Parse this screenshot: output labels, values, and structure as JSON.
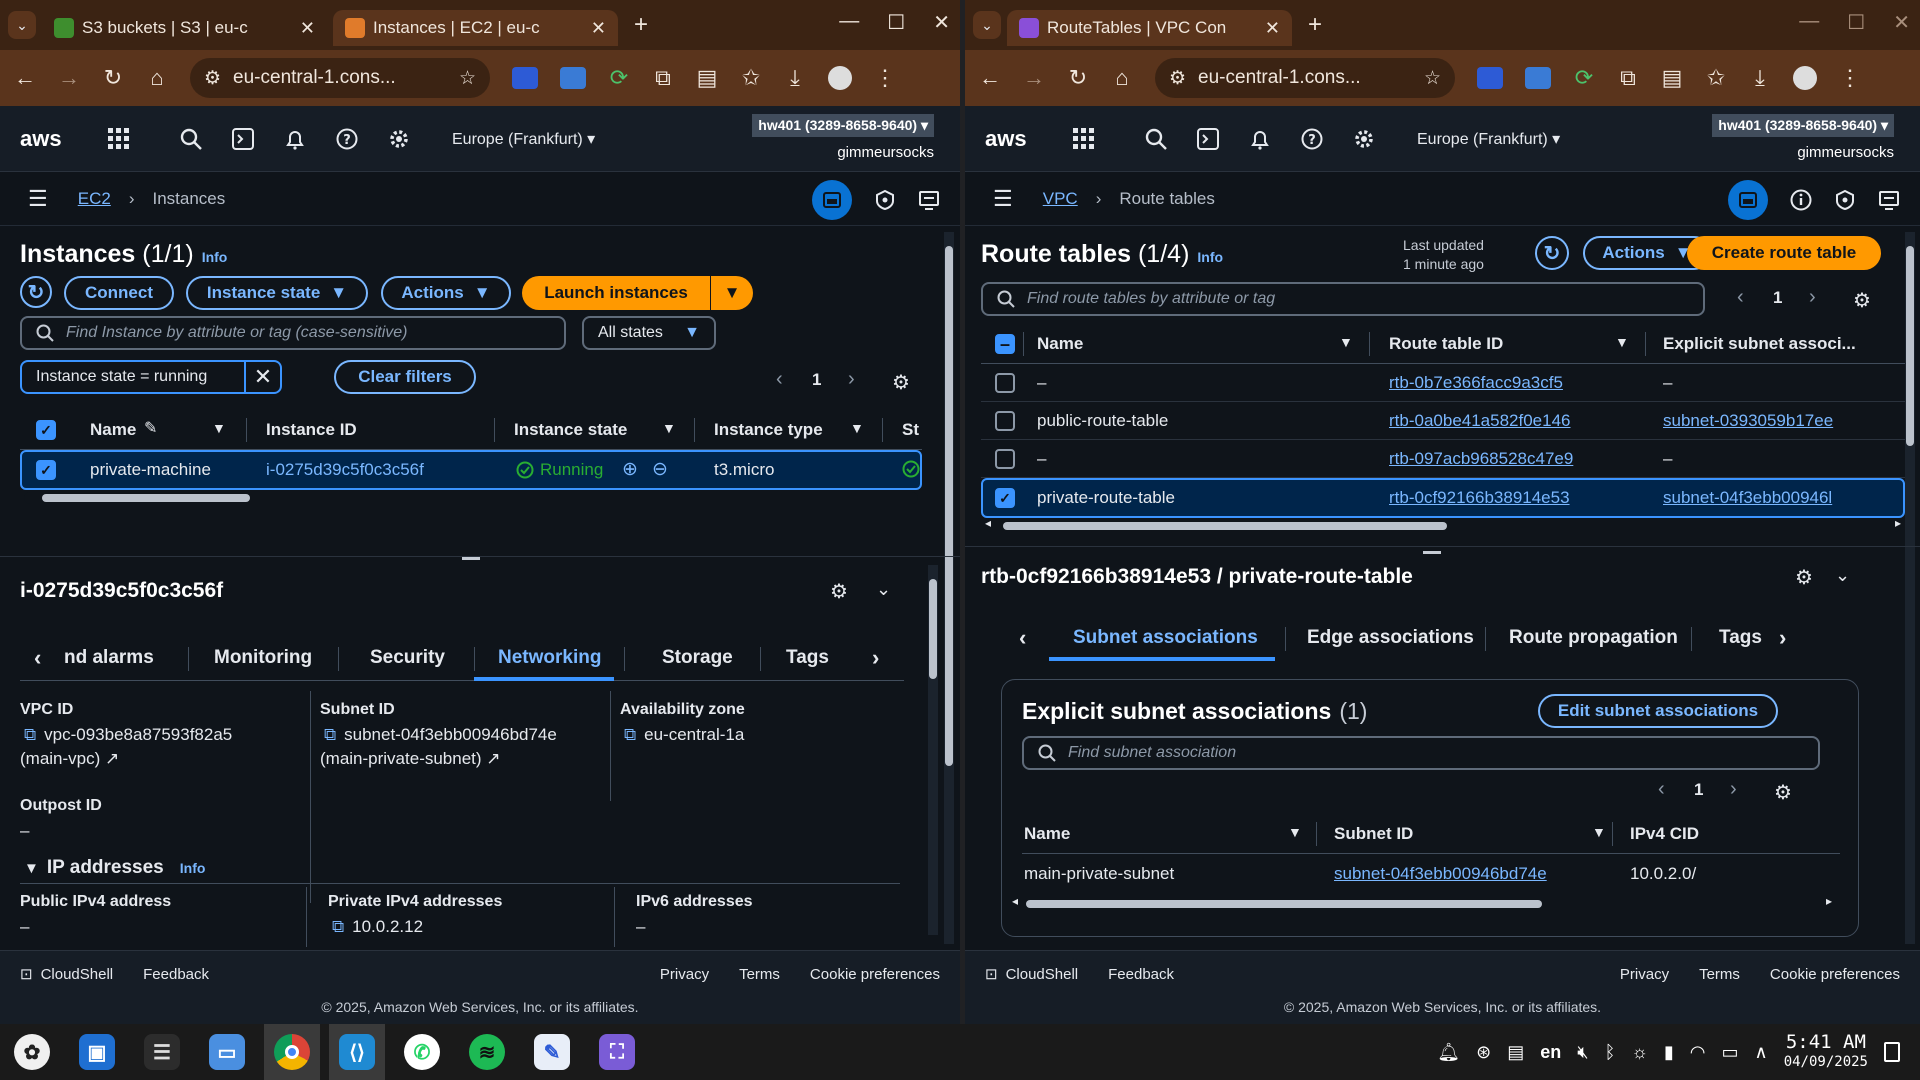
{
  "left": {
    "browser": {
      "tabs": [
        {
          "title": "S3 buckets | S3 | eu-c",
          "fav_color": "#3e8e2e",
          "active": false
        },
        {
          "title": "Instances | EC2 | eu-c",
          "fav_color": "#e07b2b",
          "active": true
        }
      ],
      "url": "eu-central-1.cons..."
    },
    "aws": {
      "region": "Europe (Frankfurt)",
      "account": "hw401 (3289-8658-9640)",
      "user": "gimmeursocks"
    },
    "breadcrumb": {
      "service": "EC2",
      "page": "Instances"
    },
    "page": {
      "title": "Instances",
      "count": "(1/1)",
      "info": "Info",
      "buttons": {
        "connect": "Connect",
        "instance_state": "Instance state",
        "actions": "Actions",
        "launch": "Launch instances"
      },
      "search_placeholder": "Find Instance by attribute or tag (case-sensitive)",
      "states_select": "All states",
      "filter_token": "Instance state = running",
      "clear_filters": "Clear filters",
      "page_num": "1",
      "columns": [
        "Name",
        "Instance ID",
        "Instance state",
        "Instance type",
        "St"
      ],
      "row": {
        "name": "private-machine",
        "id": "i-0275d39c5f0c3c56f",
        "state": "Running",
        "type": "t3.micro"
      }
    },
    "details": {
      "title": "i-0275d39c5f0c3c56f",
      "tabs": [
        "nd alarms",
        "Monitoring",
        "Security",
        "Networking",
        "Storage",
        "Tags"
      ],
      "active_tab": "Networking",
      "vpc_label": "VPC ID",
      "vpc_value": "vpc-093be8a87593f82a5",
      "vpc_name": "(main-vpc)",
      "subnet_label": "Subnet ID",
      "subnet_value": "subnet-04f3ebb00946bd74e",
      "subnet_name": "(main-private-subnet)",
      "az_label": "Availability zone",
      "az_value": "eu-central-1a",
      "outpost_label": "Outpost ID",
      "outpost_value": "–",
      "ip_section": "IP addresses",
      "ip_info": "Info",
      "public_label": "Public IPv4 address",
      "public_value": "–",
      "private_label": "Private IPv4 addresses",
      "private_value": "10.0.2.12",
      "ipv6_label": "IPv6 addresses",
      "ipv6_value": "–"
    },
    "footer": {
      "cloudshell": "CloudShell",
      "feedback": "Feedback",
      "privacy": "Privacy",
      "terms": "Terms",
      "cookies": "Cookie preferences",
      "copyright": "© 2025, Amazon Web Services, Inc. or its affiliates."
    }
  },
  "right": {
    "browser": {
      "tabs": [
        {
          "title": "RouteTables | VPC Con",
          "fav_color": "#8a4fd8",
          "active": true
        }
      ],
      "url": "eu-central-1.cons..."
    },
    "aws": {
      "region": "Europe (Frankfurt)",
      "account": "hw401 (3289-8658-9640)",
      "user": "gimmeursocks"
    },
    "breadcrumb": {
      "service": "VPC",
      "page": "Route tables"
    },
    "page": {
      "title": "Route tables",
      "count": "(1/4)",
      "info": "Info",
      "last_updated_1": "Last updated",
      "last_updated_2": "1 minute ago",
      "actions": "Actions",
      "create": "Create route table",
      "search_placeholder": "Find route tables by attribute or tag",
      "page_num": "1",
      "columns": [
        "Name",
        "Route table ID",
        "Explicit subnet associ..."
      ],
      "rows": [
        {
          "name": "–",
          "id": "rtb-0b7e366facc9a3cf5",
          "subnet": "–",
          "checked": false
        },
        {
          "name": "public-route-table",
          "id": "rtb-0a0be41a582f0e146",
          "subnet": "subnet-0393059b17ee",
          "checked": false
        },
        {
          "name": "–",
          "id": "rtb-097acb968528c47e9",
          "subnet": "–",
          "checked": false
        },
        {
          "name": "private-route-table",
          "id": "rtb-0cf92166b38914e53",
          "subnet": "subnet-04f3ebb00946l",
          "checked": true
        }
      ]
    },
    "details": {
      "title": "rtb-0cf92166b38914e53 / private-route-table",
      "tabs": [
        "Subnet associations",
        "Edge associations",
        "Route propagation",
        "Tags"
      ],
      "active_tab": "Subnet associations",
      "panel_title": "Explicit subnet associations",
      "panel_count": "(1)",
      "edit_button": "Edit subnet associations",
      "search_placeholder": "Find subnet association",
      "page_num": "1",
      "columns": [
        "Name",
        "Subnet ID",
        "IPv4 CID"
      ],
      "row": {
        "name": "main-private-subnet",
        "id": "subnet-04f3ebb00946bd74e",
        "cidr": "10.0.2.0/"
      }
    },
    "footer": {
      "cloudshell": "CloudShell",
      "feedback": "Feedback",
      "privacy": "Privacy",
      "terms": "Terms",
      "cookies": "Cookie preferences",
      "copyright": "© 2025, Amazon Web Services, Inc. or its affiliates."
    }
  },
  "taskbar": {
    "apps": [
      "settings",
      "store",
      "files-manager",
      "file-explorer",
      "chrome",
      "vscode",
      "whatsapp",
      "spotify",
      "word-editor",
      "screenshot"
    ],
    "lang": "en",
    "time": "5:41 AM",
    "date": "04/09/2025"
  },
  "colors": {
    "accent": "#7ab7ff",
    "primary_button": "#ff9900",
    "selected_blue": "#3b94ff",
    "running_green": "#29ad32"
  }
}
